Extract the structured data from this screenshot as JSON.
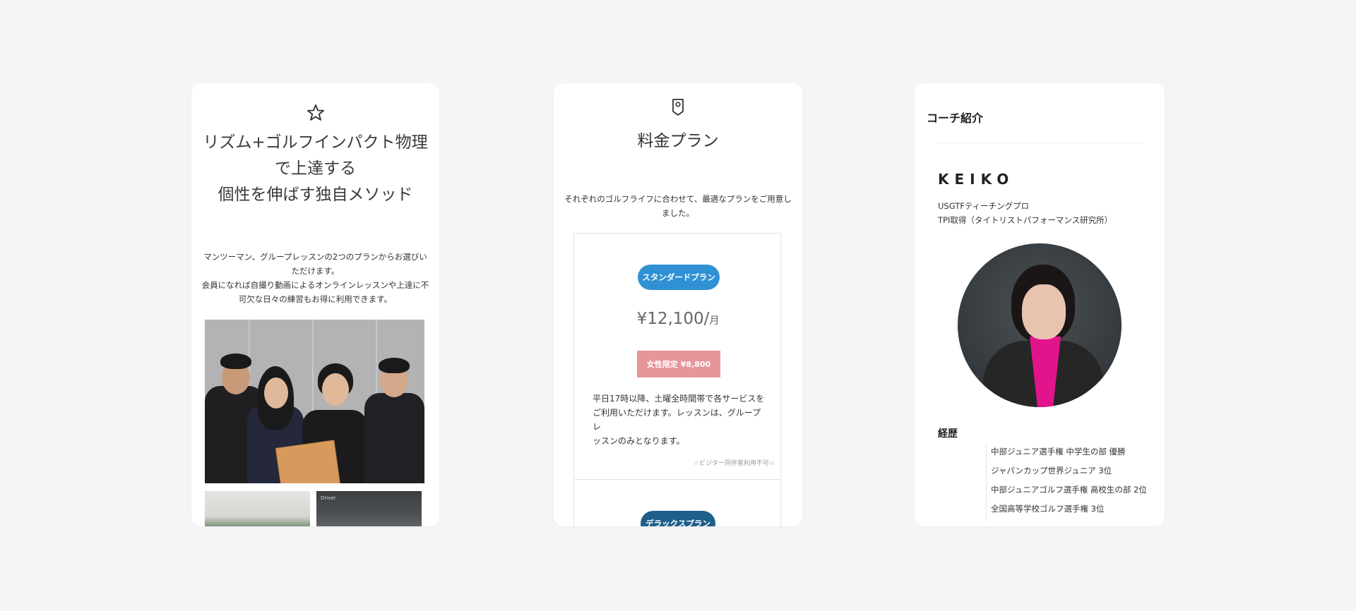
{
  "card1": {
    "icon": "star-icon",
    "title_lines": [
      "リズム+ゴルフインパクト物理",
      "で上達する",
      "個性を伸ばす独自メソッド"
    ],
    "desc_lines": [
      "マンツーマン、グループレッスンの2つのプランからお選びい",
      "ただけます。",
      "会員になれば自撮り動画によるオンラインレッスンや上達に不",
      "可欠な日々の練習もお得に利用できます。"
    ],
    "thumb2_label": "Driver"
  },
  "card2": {
    "icon": "map-pin-icon",
    "title": "料金プラン",
    "desc_lines": [
      "それぞれのゴルフライフに合わせて、最適なプランをご用意し",
      "ました。"
    ],
    "plan1": {
      "badge": "スタンダードプラン",
      "price": "¥12,100/",
      "unit": "月",
      "ladies": "女性限定 ¥8,800",
      "text_lines": [
        "平日17時以降、土曜全時間帯で各サービスを",
        "ご利用いただけます。レッスンは、グループレ",
        "ッスンのみとなります。"
      ],
      "note": "☆ビジター同伴者利用不可☆"
    },
    "plan2": {
      "badge": "デラックスプラン"
    },
    "colors": {
      "standard": "#2f91d4",
      "deluxe": "#1e5f8c",
      "ladies": "#e7959a"
    }
  },
  "card3": {
    "title": "コーチ紹介",
    "coach_name": "KEIKO",
    "cred_lines": [
      "USGTFティーチングプロ",
      "TPI取得（タイトリストパフォーマンス研究所）"
    ],
    "history_title": "経歴",
    "history": [
      "中部ジュニア選手権 中学生の部 優勝",
      "ジャパンカップ世界ジュニア 3位",
      "中部ジュニアゴルフ選手権 高校生の部 2位",
      "全国高等学校ゴルフ選手権 3位"
    ]
  }
}
